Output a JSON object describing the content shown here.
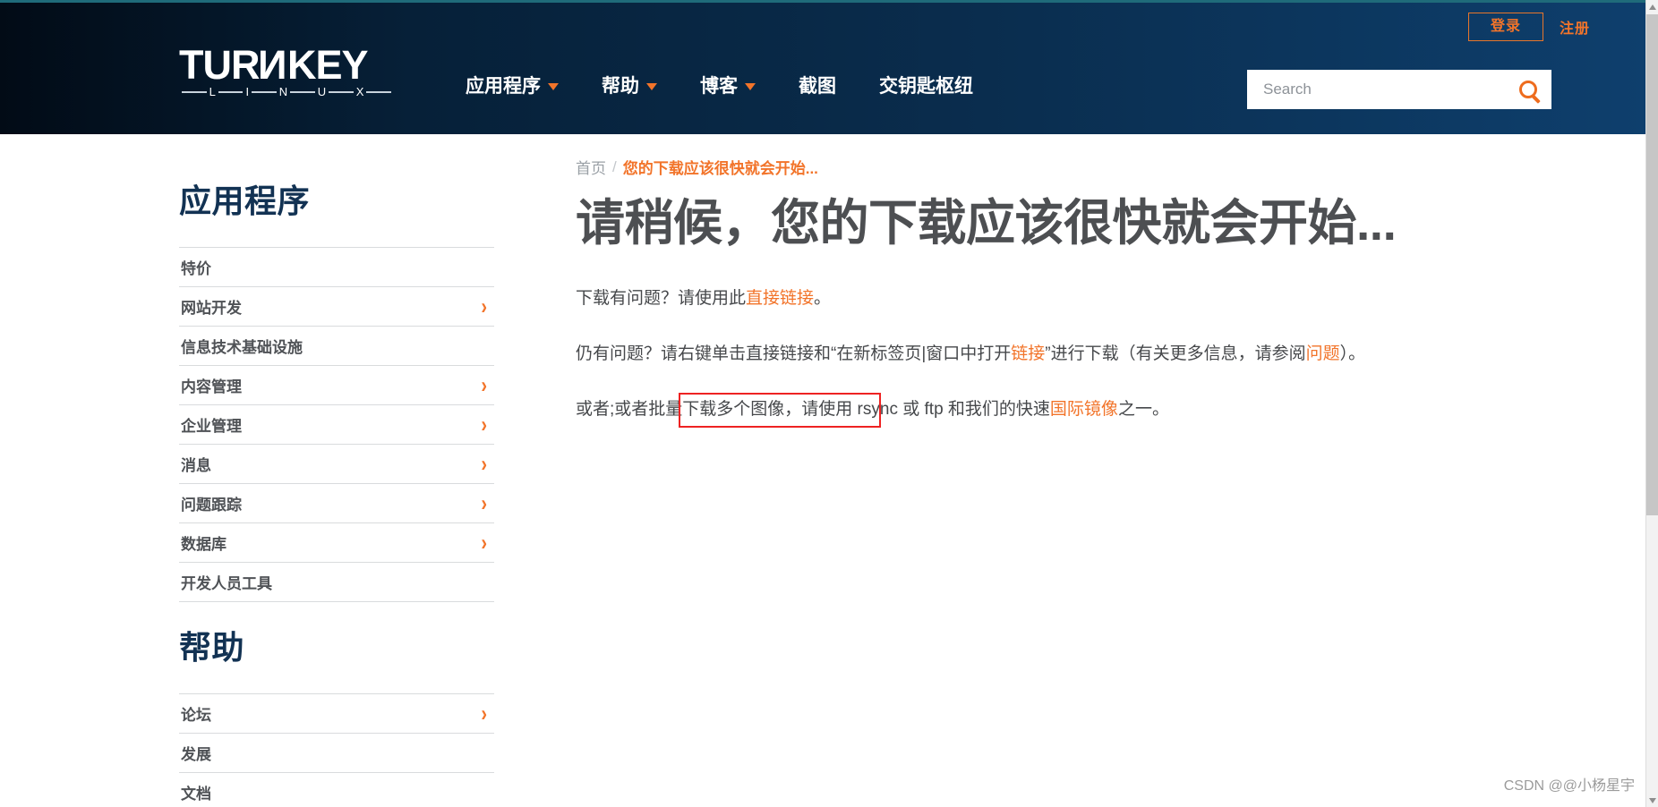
{
  "header": {
    "logo": {
      "word_part1": "TUR",
      "word_rev_n": "N",
      "word_part2": "KEY",
      "sub_letters": [
        "L",
        "I",
        "N",
        "U",
        "X"
      ]
    },
    "auth": {
      "login_label": "登录",
      "register_label": "注册"
    },
    "nav": [
      {
        "label": "应用程序",
        "has_dropdown": true
      },
      {
        "label": "帮助",
        "has_dropdown": true
      },
      {
        "label": "博客",
        "has_dropdown": true
      },
      {
        "label": "截图",
        "has_dropdown": false
      },
      {
        "label": "交钥匙枢纽",
        "has_dropdown": false
      }
    ],
    "search": {
      "placeholder": "Search",
      "value": "",
      "icon": "search-icon"
    }
  },
  "sidebar": {
    "sections": [
      {
        "heading": "应用程序",
        "items": [
          {
            "label": "特价",
            "has_chevron": false
          },
          {
            "label": "网站开发",
            "has_chevron": true
          },
          {
            "label": "信息技术基础设施",
            "has_chevron": false
          },
          {
            "label": "内容管理",
            "has_chevron": true
          },
          {
            "label": "企业管理",
            "has_chevron": true
          },
          {
            "label": "消息",
            "has_chevron": true
          },
          {
            "label": "问题跟踪",
            "has_chevron": true
          },
          {
            "label": "数据库",
            "has_chevron": true
          },
          {
            "label": "开发人员工具",
            "has_chevron": false
          }
        ]
      },
      {
        "heading": "帮助",
        "items": [
          {
            "label": "论坛",
            "has_chevron": true
          },
          {
            "label": "发展",
            "has_chevron": false
          },
          {
            "label": "文档",
            "has_chevron": false
          }
        ]
      }
    ]
  },
  "main": {
    "breadcrumb": {
      "home": "首页",
      "separator": "/",
      "current": "您的下载应该很快就会开始..."
    },
    "title": "请稍候，您的下载应该很快就会开始...",
    "paragraphs": {
      "p1_a": "下载有问题？请使用此",
      "p1_link": "直接链接",
      "p1_b": "。",
      "p2_a": "仍有问题？请右键单击直接链接和“在新标签页|窗口中打开",
      "p2_link1": "链接",
      "p2_b": "”进行下载（有关更多信息，请参阅",
      "p2_link2": "问题",
      "p2_c": "）。",
      "p3_a": "或者;或者批量下载多个图像，请使用 rsync 或 ftp 和我们的快速",
      "p3_link": "国际镜像",
      "p3_b": "之一。"
    }
  },
  "annotation": {
    "type": "red-rectangle",
    "color": "#ee2222"
  },
  "scrollbar": {
    "up_icon": "chevron-up-icon",
    "down_icon": "chevron-down-icon"
  },
  "watermark": "CSDN @@小杨星宇",
  "colors": {
    "header_dark": "#0a2d4e",
    "accent_orange": "#f2742a",
    "heading_navy": "#123253",
    "text_gray": "#4d4f52",
    "annotation_red": "#ee2222"
  }
}
